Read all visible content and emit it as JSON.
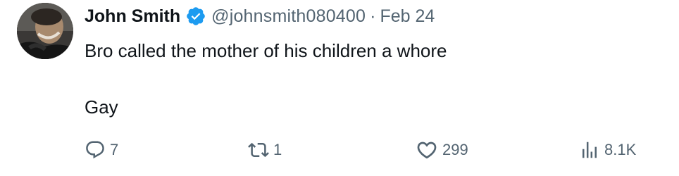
{
  "tweet": {
    "display_name": "John Smith",
    "verified": true,
    "handle": "@johnsmith080400",
    "separator": "·",
    "date": "Feb 24",
    "text_line1": "Bro called the mother of his children a whore",
    "text_line2": "Gay"
  },
  "actions": {
    "replies": "7",
    "retweets": "1",
    "likes": "299",
    "views": "8.1K"
  },
  "colors": {
    "text_primary": "#0f1419",
    "text_secondary": "#536471",
    "verified_badge": "#1d9bf0"
  },
  "icons": [
    "avatar",
    "verified-badge-icon",
    "reply-icon",
    "retweet-icon",
    "like-icon",
    "views-icon"
  ]
}
